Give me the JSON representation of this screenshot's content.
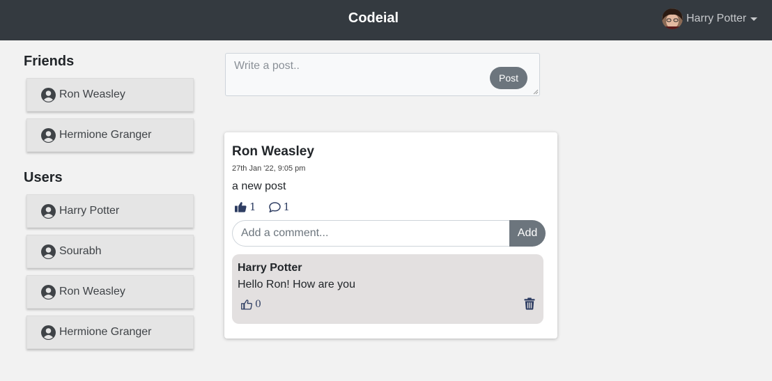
{
  "navbar": {
    "brand": "Codeial",
    "user_name": "Harry Potter"
  },
  "sidebar": {
    "friends_title": "Friends",
    "friends": [
      {
        "name": "Ron Weasley"
      },
      {
        "name": "Hermione Granger"
      }
    ],
    "users_title": "Users",
    "users": [
      {
        "name": "Harry Potter"
      },
      {
        "name": "Sourabh"
      },
      {
        "name": "Ron Weasley"
      },
      {
        "name": "Hermione Granger"
      }
    ]
  },
  "composer": {
    "placeholder": "Write a post..",
    "post_label": "Post"
  },
  "post": {
    "author": "Ron Weasley",
    "time": "27th Jan '22, 9:05 pm",
    "content": "a new post",
    "likes": "1",
    "comments_count": "1",
    "comment_placeholder": "Add a comment...",
    "add_label": "Add",
    "comments": [
      {
        "author": "Harry Potter",
        "text": "Hello Ron! How are you",
        "likes": "0"
      }
    ]
  },
  "colors": {
    "navbar": "#343a40",
    "button": "#6c757d",
    "icon_accent": "#2f3e63",
    "comment_bg": "#e3e0e0",
    "sidebar_item": "#e5e5e5"
  },
  "icons": {
    "user": "user-circle-icon",
    "like_filled": "thumbs-up-solid-icon",
    "like_outline": "thumbs-up-outline-icon",
    "comment": "comment-bubble-icon",
    "delete": "trash-icon",
    "dropdown": "caret-down-icon"
  }
}
